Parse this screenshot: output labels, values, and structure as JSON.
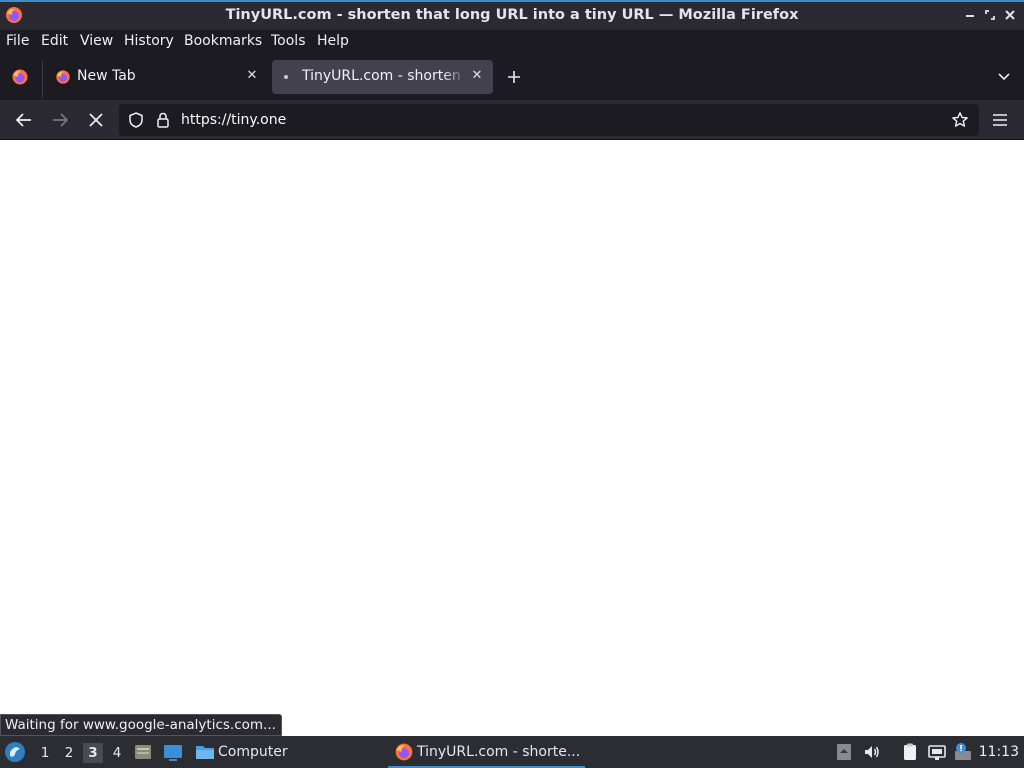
{
  "window": {
    "title": "TinyURL.com - shorten that long URL into a tiny URL — Mozilla Firefox"
  },
  "menu": {
    "items": [
      {
        "label": "File",
        "accel": "F"
      },
      {
        "label": "Edit",
        "accel": "E"
      },
      {
        "label": "View",
        "accel": "V"
      },
      {
        "label": "History",
        "accel": "s"
      },
      {
        "label": "Bookmarks",
        "accel": "B"
      },
      {
        "label": "Tools",
        "accel": "T"
      },
      {
        "label": "Help",
        "accel": "H"
      }
    ]
  },
  "tabs": [
    {
      "label": "New Tab",
      "active": false
    },
    {
      "label": "TinyURL.com - shorten that long URL into a tiny URL",
      "active": true
    }
  ],
  "navbar": {
    "url": "https://tiny.one"
  },
  "status": {
    "text": "Waiting for www.google-analytics.com..."
  },
  "taskbar": {
    "workspaces": [
      "1",
      "2",
      "3",
      "4"
    ],
    "active_workspace": "3",
    "places_label": "Computer",
    "window_task_label": "TinyURL.com - shorte...",
    "clock": "11:13"
  },
  "colors": {
    "accent": "#3c8fc8",
    "chrome_dark": "#1c1b22",
    "toolbar": "#2b2a33",
    "active_tab": "#42414d"
  },
  "icons": {
    "firefox": "firefox-icon",
    "back": "back-arrow-icon",
    "forward": "forward-arrow-icon",
    "stop": "stop-icon",
    "shield": "tracking-shield-icon",
    "lock": "lock-icon",
    "star": "bookmark-star-icon",
    "menu": "hamburger-menu-icon"
  }
}
